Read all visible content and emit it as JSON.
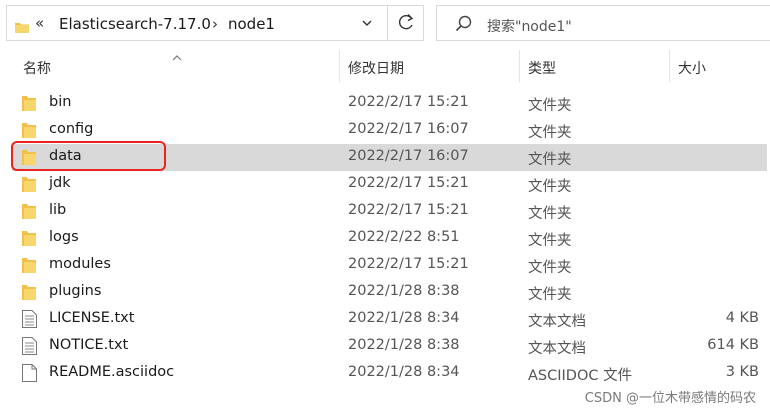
{
  "address_bar": {
    "chevron": "«",
    "segments": [
      "Elasticsearch-7.17.0",
      "node1"
    ],
    "separator": "›"
  },
  "search": {
    "placeholder": "搜索\"node1\""
  },
  "columns": {
    "name": "名称",
    "date": "修改日期",
    "type": "类型",
    "size": "大小"
  },
  "files": [
    {
      "name": "bin",
      "date": "2022/2/17 15:21",
      "type": "文件夹",
      "size": "",
      "icon": "folder-icon"
    },
    {
      "name": "config",
      "date": "2022/2/17 16:07",
      "type": "文件夹",
      "size": "",
      "icon": "folder-icon"
    },
    {
      "name": "data",
      "date": "2022/2/17 16:07",
      "type": "文件夹",
      "size": "",
      "icon": "folder-icon",
      "selected": true
    },
    {
      "name": "jdk",
      "date": "2022/2/17 15:21",
      "type": "文件夹",
      "size": "",
      "icon": "folder-icon"
    },
    {
      "name": "lib",
      "date": "2022/2/17 15:21",
      "type": "文件夹",
      "size": "",
      "icon": "folder-icon"
    },
    {
      "name": "logs",
      "date": "2022/2/22 8:51",
      "type": "文件夹",
      "size": "",
      "icon": "folder-icon"
    },
    {
      "name": "modules",
      "date": "2022/2/17 15:21",
      "type": "文件夹",
      "size": "",
      "icon": "folder-icon"
    },
    {
      "name": "plugins",
      "date": "2022/1/28 8:38",
      "type": "文件夹",
      "size": "",
      "icon": "folder-icon"
    },
    {
      "name": "LICENSE.txt",
      "date": "2022/1/28 8:34",
      "type": "文本文档",
      "size": "4 KB",
      "icon": "text-file-icon"
    },
    {
      "name": "NOTICE.txt",
      "date": "2022/1/28 8:38",
      "type": "文本文档",
      "size": "614 KB",
      "icon": "text-file-icon"
    },
    {
      "name": "README.asciidoc",
      "date": "2022/1/28 8:34",
      "type": "ASCIIDOC 文件",
      "size": "3 KB",
      "icon": "document-icon"
    }
  ],
  "watermark": "CSDN @一位木带感情的码农",
  "colors": {
    "folder": "#f3c14a",
    "selection": "#d9d9d9",
    "highlight_border": "#e8261f"
  }
}
